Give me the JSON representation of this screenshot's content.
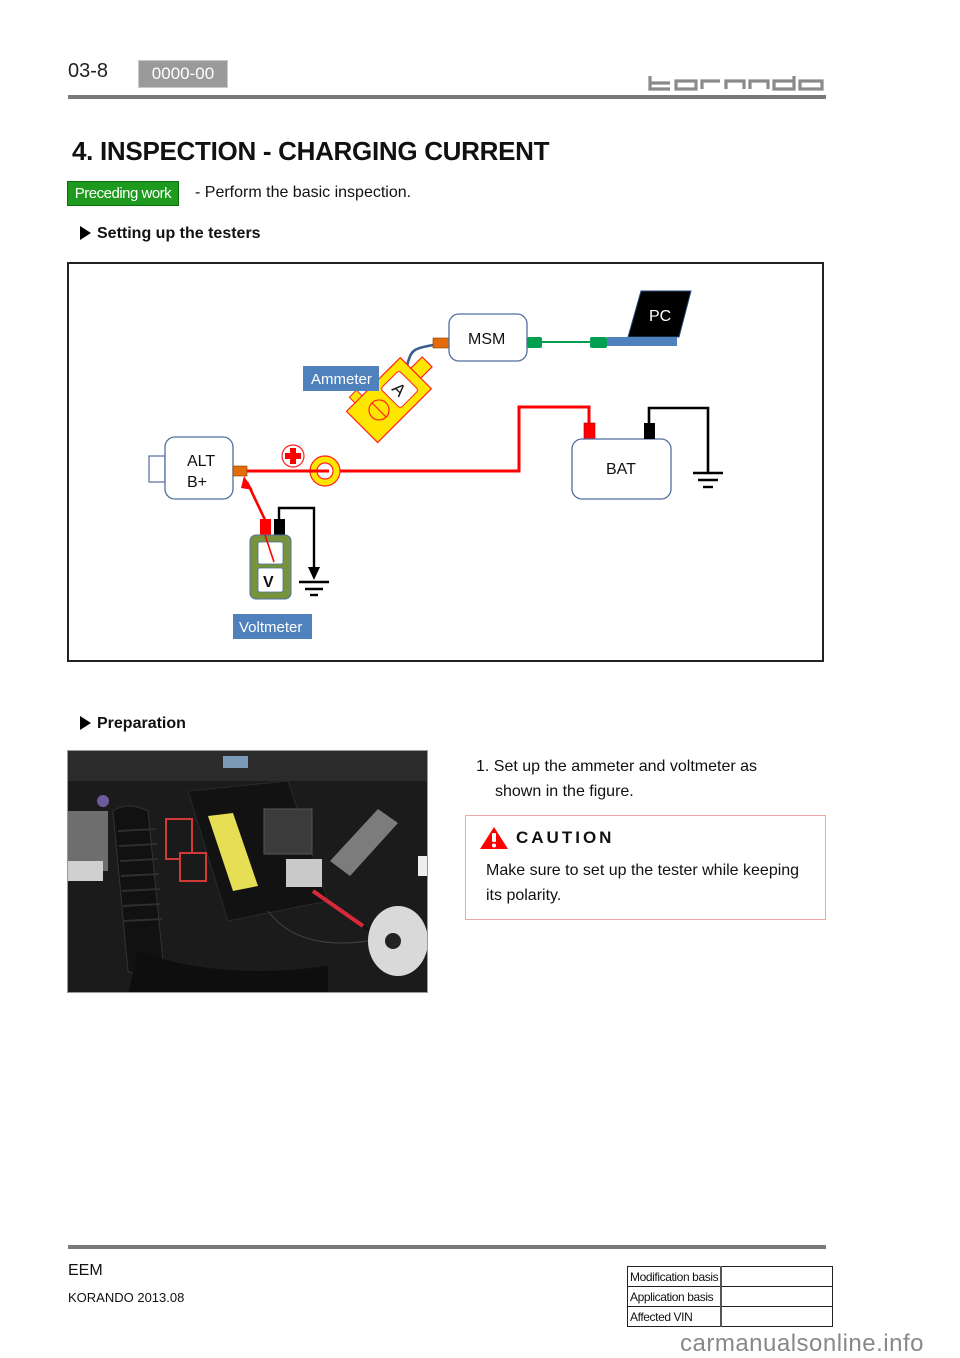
{
  "header": {
    "page_number": "03-8",
    "code_badge": "0000-00",
    "brand": "korando"
  },
  "title": "4. INSPECTION - CHARGING CURRENT",
  "preceding_work": {
    "badge": "Preceding work",
    "text": "-  Perform the basic inspection."
  },
  "sections": {
    "setup": "Setting up the testers",
    "preparation": "Preparation"
  },
  "diagram": {
    "labels": {
      "alt": "ALT",
      "alt_terminal": "B+",
      "msm": "MSM",
      "pc": "PC",
      "bat": "BAT",
      "ammeter": "Ammeter",
      "ammeter_symbol": "A",
      "voltmeter": "Voltmeter",
      "voltmeter_symbol": "V"
    },
    "colors": {
      "positive_wire": "#ff0000",
      "ground_wire": "#000000",
      "data_cable": "#00a050",
      "probe_cable": "#3a5f8f",
      "label_bg": "#4f81bd",
      "ammeter_body": "#ffe600",
      "voltmeter_body": "#77933c",
      "connector_orange": "#e36c09"
    }
  },
  "photo": {
    "alt": "Engine bay showing ammeter clamp and voltmeter probe connected to battery"
  },
  "steps": [
    {
      "number": "1.",
      "text_line1": "Set up the ammeter and voltmeter as",
      "text_line2": "shown in the figure."
    }
  ],
  "caution": {
    "title": "CAUTION",
    "line1": "Make sure to set up the tester while keeping",
    "line2": "its polarity."
  },
  "footer": {
    "manual": "EEM",
    "model": "KORANDO 2013.08",
    "rev_table": [
      {
        "label": "Modification basis",
        "value": ""
      },
      {
        "label": "Application basis",
        "value": ""
      },
      {
        "label": "Affected VIN",
        "value": ""
      }
    ],
    "watermark": "carmanualsonline.info"
  }
}
